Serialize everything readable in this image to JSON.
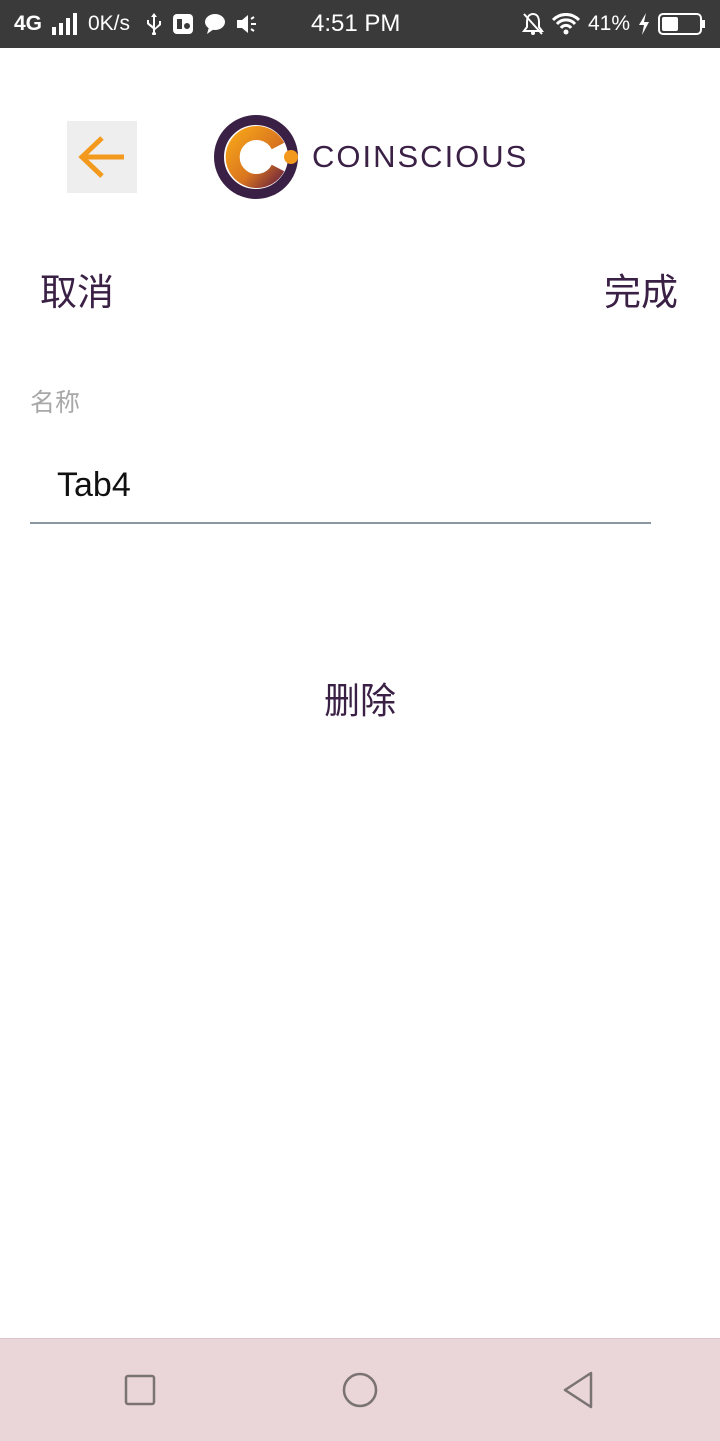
{
  "status_bar": {
    "network": "4G",
    "speed": "0K/s",
    "time": "4:51 PM",
    "battery": "41%",
    "icons": [
      "signal-icon",
      "usb-icon",
      "app-notification-icon",
      "chat-icon",
      "volume-icon",
      "mute-bell-icon",
      "wifi-icon",
      "charging-icon",
      "battery-icon"
    ]
  },
  "header": {
    "back_icon": "arrow-left-icon",
    "logo_text": "COINSCIOUS"
  },
  "actions": {
    "cancel_label": "取消",
    "done_label": "完成"
  },
  "form": {
    "name_label": "名称",
    "name_value": "Tab4"
  },
  "delete_label": "删除",
  "colors": {
    "accent_orange": "#F39A1E",
    "brand_purple": "#3A2045",
    "nav_bar_bg": "#EAD5D8",
    "status_bar_bg": "#3A3A3A"
  },
  "nav_bar": {
    "icons": [
      "recent-apps-icon",
      "home-icon",
      "back-icon"
    ]
  }
}
